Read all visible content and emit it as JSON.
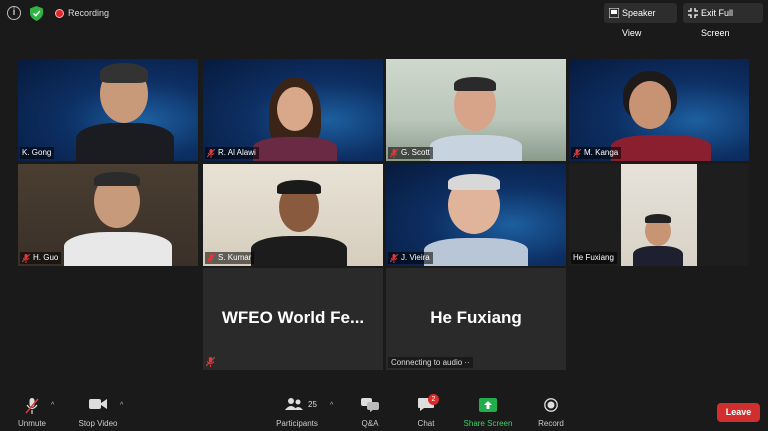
{
  "topbar": {
    "recording_label": "Recording",
    "speaker_view_label": "Speaker View",
    "exit_fullscreen_label": "Exit Full Screen"
  },
  "tiles": [
    {
      "name": "K. Gong"
    },
    {
      "name": "R. Al Alawi"
    },
    {
      "name": "G. Scott"
    },
    {
      "name": "M. Kanga"
    },
    {
      "name": "H. Guo"
    },
    {
      "name": "S. Kumar"
    },
    {
      "name": "J. Vieira"
    },
    {
      "name": "He Fuxiang"
    }
  ],
  "name_tiles": [
    {
      "display": "WFEO World Fe..."
    },
    {
      "display": "He Fuxiang",
      "status": "Connecting to audio"
    }
  ],
  "toolbar": {
    "unmute": "Unmute",
    "stop_video": "Stop Video",
    "participants": "Participants",
    "participants_count": "25",
    "qa": "Q&A",
    "chat": "Chat",
    "chat_badge": "2",
    "share_screen": "Share Screen",
    "record": "Record",
    "leave": "Leave"
  },
  "colors": {
    "active_speaker": "#c7d33a",
    "leave": "#d12e2e",
    "share": "#1fae4a"
  }
}
